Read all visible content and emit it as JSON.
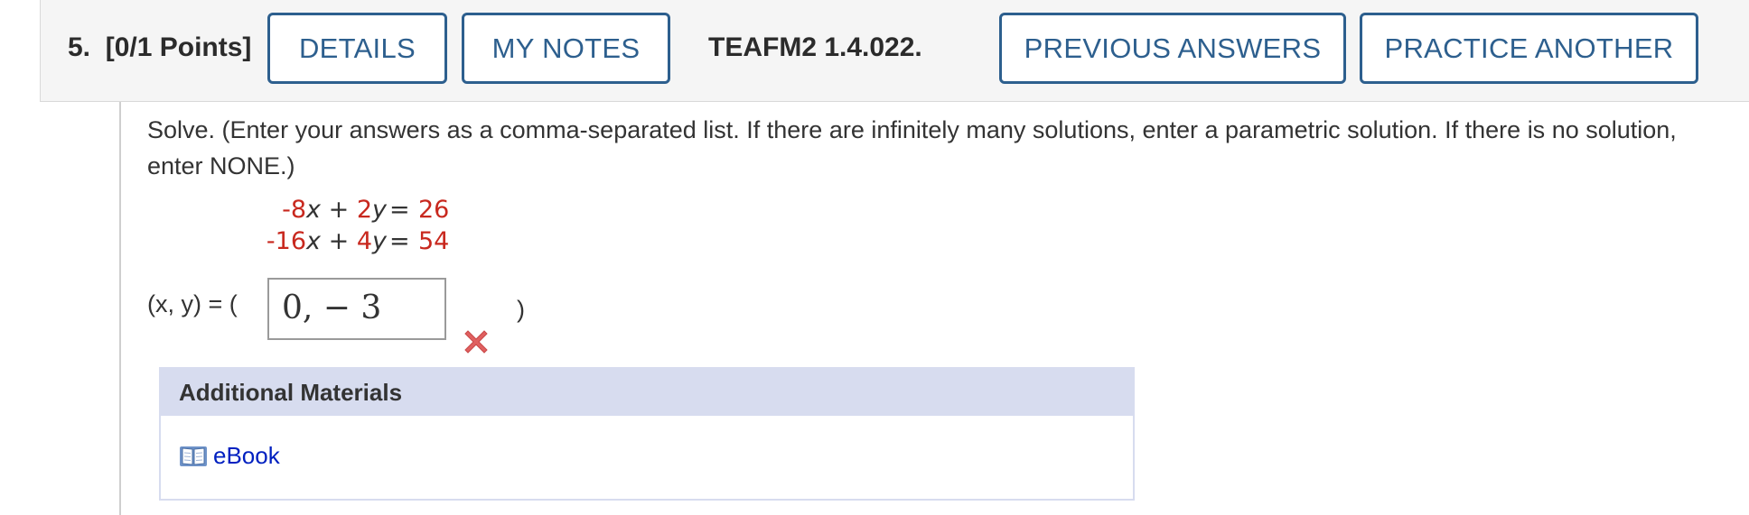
{
  "header": {
    "question_number": "5.",
    "points": "[0/1 Points]",
    "details_label": "DETAILS",
    "my_notes_label": "MY NOTES",
    "question_code": "TEAFM2 1.4.022.",
    "previous_answers_label": "PREVIOUS ANSWERS",
    "practice_another_label": "PRACTICE ANOTHER"
  },
  "question": {
    "prompt": "Solve. (Enter your answers as a comma-separated list. If there are infinitely many solutions, enter a parametric solution. If there is no solution, enter NONE.)",
    "equations": [
      {
        "x_coef": "-8",
        "x_var": "x",
        "op": "+",
        "y_coef": "2",
        "y_var": "y",
        "eq": "=",
        "rhs": "26"
      },
      {
        "x_coef": "-16",
        "x_var": "x",
        "op": "+",
        "y_coef": "4",
        "y_var": "y",
        "eq": "=",
        "rhs": "54"
      }
    ],
    "answer_label_open": "(x, y) = (",
    "answer_value": "0, − 3",
    "answer_label_close": ")",
    "answer_status": "incorrect",
    "answer_status_icon": "red-x-icon"
  },
  "additional_materials": {
    "title": "Additional Materials",
    "links": [
      {
        "icon": "book-icon",
        "label": "eBook"
      }
    ]
  },
  "colors": {
    "button_border": "#2d5f8e",
    "coefficient_red": "#c8281e",
    "materials_header_bg": "#d7dcef",
    "link_blue": "#0020c0",
    "wrong_red": "#e06060"
  }
}
